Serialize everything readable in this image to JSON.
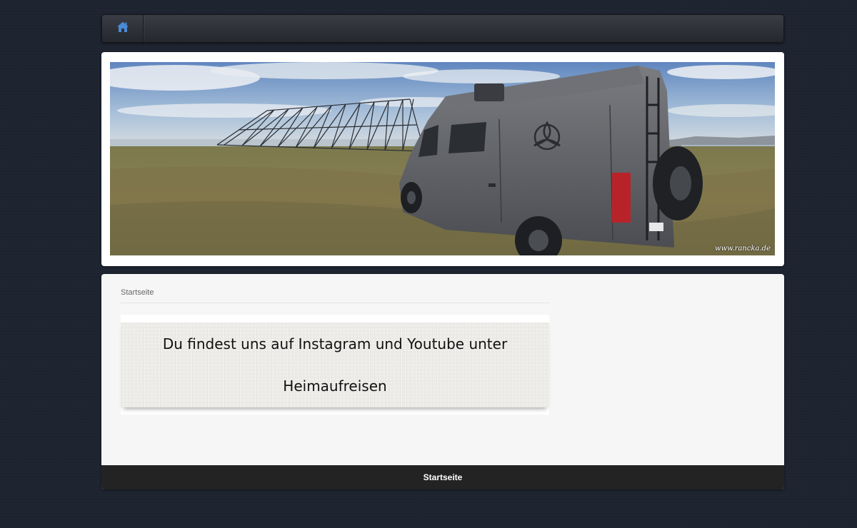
{
  "navbar": {
    "home_icon": "home-icon",
    "accent": "#4a8ad6"
  },
  "header": {
    "banner_image": "camper-van-landscape",
    "watermark": "www.rancka.de"
  },
  "breadcrumb": {
    "label": "Startseite"
  },
  "message": {
    "line1": "Du findest uns auf Instagram und Youtube unter",
    "line2": "Heimaufreisen"
  },
  "footer": {
    "link_label": "Startseite"
  }
}
